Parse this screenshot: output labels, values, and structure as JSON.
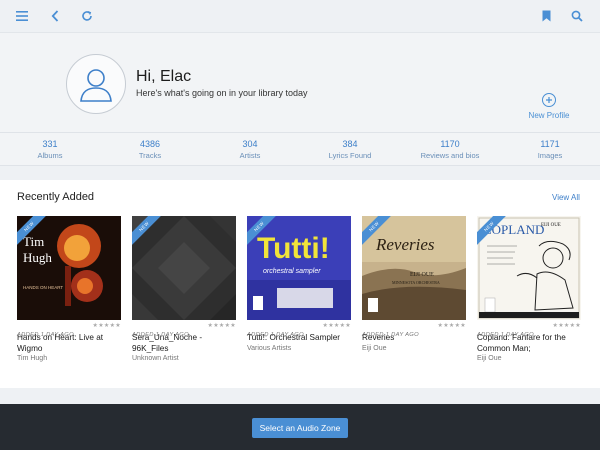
{
  "toolbar": {
    "menu_icon": "menu-icon",
    "back_icon": "back-arrow-icon",
    "refresh_icon": "refresh-icon",
    "bookmark_icon": "bookmark-icon",
    "search_icon": "search-icon"
  },
  "profile": {
    "greeting": "Hi, Elac",
    "subtitle": "Here's what's going on in your library today",
    "new_profile_label": "New Profile"
  },
  "stats": [
    {
      "value": "331",
      "label": "Albums"
    },
    {
      "value": "4386",
      "label": "Tracks"
    },
    {
      "value": "304",
      "label": "Artists"
    },
    {
      "value": "384",
      "label": "Lyrics Found"
    },
    {
      "value": "1170",
      "label": "Reviews and bios"
    },
    {
      "value": "1171",
      "label": "Images"
    }
  ],
  "recent": {
    "title": "Recently Added",
    "view_all": "View All",
    "albums": [
      {
        "badge": "NEW",
        "added": "ADDED 1 DAY AGO",
        "stars": "★★★★★",
        "title": "Hands on Heart: Live at Wigmo",
        "artist": "Tim Hugh"
      },
      {
        "badge": "NEW",
        "added": "ADDED 1 DAY AGO",
        "stars": "★★★★★",
        "title": "Sera_Una_Noche - 96K_Files",
        "artist": "Unknown Artist"
      },
      {
        "badge": "NEW",
        "added": "ADDED 1 DAY AGO",
        "stars": "★★★★★",
        "title": "Tutti!: Orchestral Sampler",
        "artist": "Various Artists"
      },
      {
        "badge": "NEW",
        "added": "ADDED 1 DAY AGO",
        "stars": "★★★★★",
        "title": "Reveries",
        "artist": "Eiji Oue"
      },
      {
        "badge": "NEW",
        "added": "ADDED 1 DAY AGO",
        "stars": "★★★★★",
        "title": "Copland: Fanfare for the Common Man;",
        "artist": "Eiji Oue"
      }
    ]
  },
  "art_text": {
    "a1_line1": "Tim",
    "a1_line2": "Hugh",
    "a1_line3": "HANDS ON HEART",
    "a3_title": "Tutti!",
    "a3_sub": "orchestral sampler",
    "a4_title": "Reveries",
    "a4_artist": "EIJI OUE",
    "a4_orch": "MINNESOTA ORCHESTRA",
    "a5_title": "COPLAND",
    "a5_artist": "EIJI OUE"
  },
  "bottom": {
    "zone_button": "Select an Audio Zone"
  },
  "colors": {
    "accent": "#4a8fd4",
    "bottom_bar": "#262b31"
  }
}
